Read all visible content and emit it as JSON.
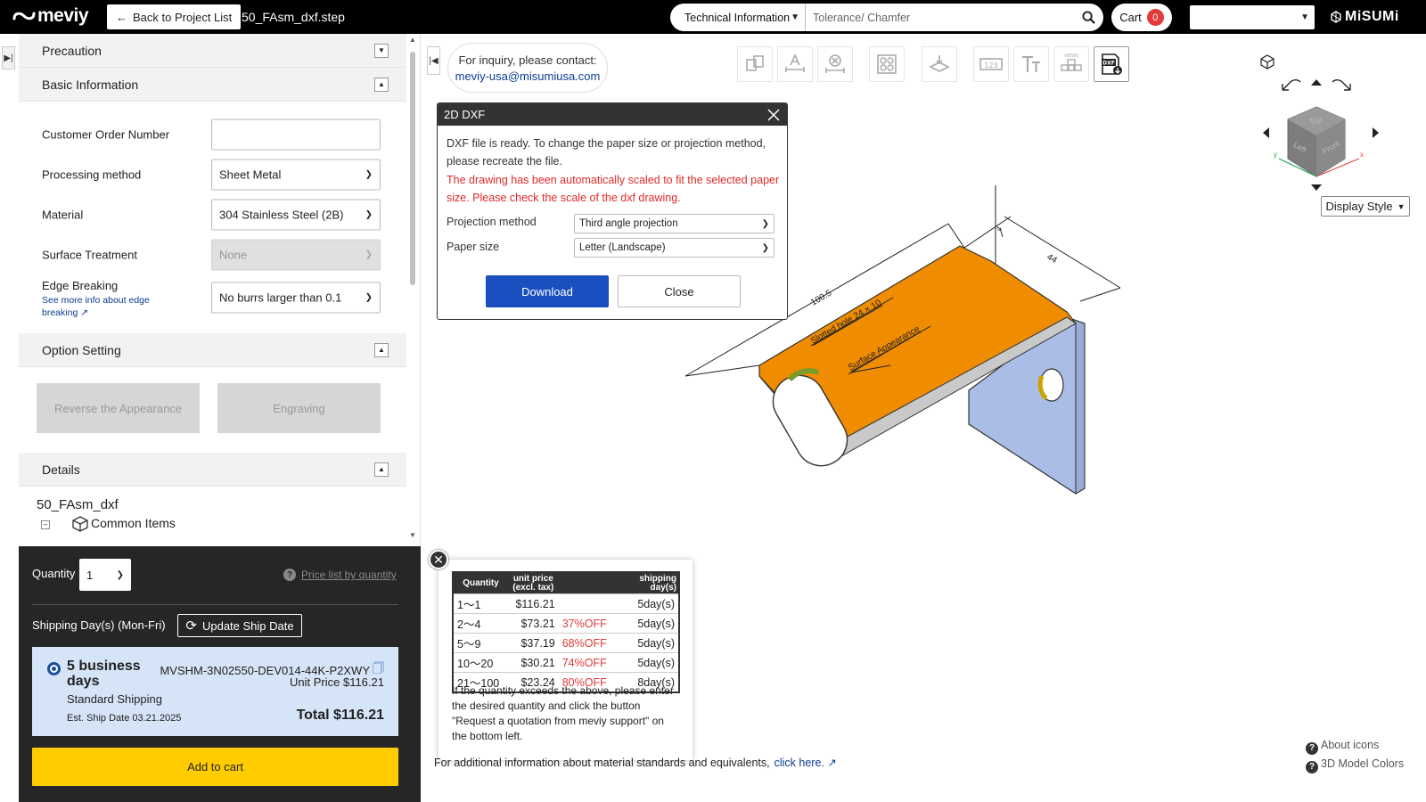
{
  "header": {
    "logo_text": "meviy",
    "back_label": "Back to Project List",
    "file_name": "50_FAsm_dxf.step",
    "search_category": "Technical Information",
    "search_placeholder": "Tolerance/ Chamfer",
    "cart_label": "Cart",
    "cart_count": "0",
    "brand": "MiSUMi"
  },
  "sidebar": {
    "precaution": "Precaution",
    "basic_info": "Basic Information",
    "fields": {
      "customer_order_label": "Customer Order Number",
      "customer_order_value": "",
      "processing_label": "Processing method",
      "processing_value": "Sheet Metal",
      "material_label": "Material",
      "material_value": "304 Stainless Steel (2B)",
      "surface_label": "Surface Treatment",
      "surface_value": "None",
      "edge_label": "Edge Breaking",
      "edge_link": "See more info about edge breaking",
      "edge_value": "No burrs larger than 0.1"
    },
    "option_setting": "Option Setting",
    "options": [
      "Reverse the Appearance",
      "Engraving"
    ],
    "details": "Details",
    "tree_root": "50_FAsm_dxf",
    "tree_child": "Common Items"
  },
  "order": {
    "qty_label": "Quantity",
    "qty_value": "1",
    "price_list_link": "Price list by quantity",
    "ship_label": "Shipping Day(s) (Mon-Fri)",
    "update_label": "Update Ship Date",
    "ship_days": "5 business days",
    "ship_type": "Standard Shipping",
    "est_ship": "Est. Ship Date 03.21.2025",
    "part_number": "MVSHM-3N02550-DEV014-44K-P2XWY",
    "unit_price": "Unit Price $116.21",
    "total": "Total $116.21",
    "add_to_cart": "Add to cart"
  },
  "viewer": {
    "inquiry_line1": "For inquiry, please contact:",
    "inquiry_email": "meviy-usa@misumiusa.com",
    "toolbar_icons": [
      "change-view-icon",
      "dimension-text-icon",
      "dimension-clear-icon",
      "hole-check-icon",
      "surface-appearance-icon",
      "measure-icon",
      "text-size-icon",
      "views-icon",
      "dxf-export-icon"
    ],
    "display_style": "Display Style",
    "about_icons": "About icons",
    "model_colors": "3D Model Colors",
    "footnote": "For additional information about material standards and equivalents,",
    "footnote_link": "click here.",
    "annotations": {
      "dim1": "100.5",
      "dim2": "44",
      "dim3": "4",
      "slot": "Slotted hole 24 × 10",
      "surface": "Surface Appearance"
    },
    "cube_faces": [
      "Top",
      "Left",
      "Front"
    ],
    "axis_labels": [
      "x",
      "y"
    ]
  },
  "dxf_dialog": {
    "title": "2D DXF",
    "message": "DXF file is ready. To change the paper size or projection method, please recreate the file.",
    "warning": "The drawing has been automatically scaled to fit the selected paper size. Please check the scale of the dxf drawing.",
    "projection_label": "Projection method",
    "projection_value": "Third angle projection",
    "paper_label": "Paper size",
    "paper_value": "Letter (Landscape)",
    "download": "Download",
    "close": "Close"
  },
  "price_table": {
    "headers": [
      "Quantity",
      "unit price (excl. tax)",
      "",
      "shipping day(s)"
    ],
    "rows": [
      {
        "qty": "1～1",
        "price": "$116.21",
        "off": "",
        "days": "5day(s)"
      },
      {
        "qty": "2～4",
        "price": "$73.21",
        "off": "37%OFF",
        "days": "5day(s)"
      },
      {
        "qty": "5～9",
        "price": "$37.19",
        "off": "68%OFF",
        "days": "5day(s)"
      },
      {
        "qty": "10～20",
        "price": "$30.21",
        "off": "74%OFF",
        "days": "5day(s)"
      },
      {
        "qty": "21～100",
        "price": "$23.24",
        "off": "80%OFF",
        "days": "8day(s)"
      }
    ],
    "note": "If the quantity exceeds the above, please enter the desired quantity and click the button \"Request a quotation from meviy support\" on the bottom left."
  },
  "colors": {
    "accent": "#1a4fc0",
    "warning": "#e02a2a",
    "add_to_cart": "#ffcc00",
    "part_top": "#f08c00",
    "part_side": "#a9bde6"
  }
}
